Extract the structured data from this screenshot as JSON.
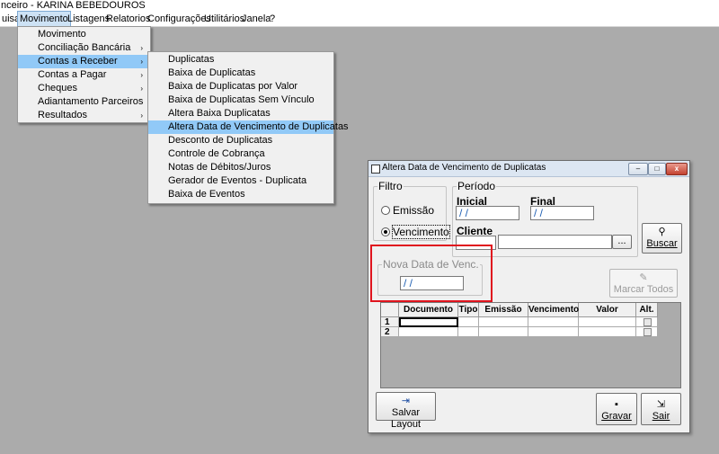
{
  "app": {
    "title": "nceiro - KARINA BEBEDOUROS"
  },
  "menubar": [
    {
      "label": "uisa"
    },
    {
      "label": "Movimento",
      "active": true
    },
    {
      "label": "Listagens"
    },
    {
      "label": "Relatorios"
    },
    {
      "label": "Configurações"
    },
    {
      "label": "Utilitários"
    },
    {
      "label": "Janela"
    },
    {
      "label": "?"
    }
  ],
  "movimento_menu": [
    {
      "label": "Movimento"
    },
    {
      "label": "Conciliação Bancária",
      "submenu": true
    },
    {
      "label": "Contas a Receber",
      "submenu": true,
      "highlight": true
    },
    {
      "label": "Contas a Pagar",
      "submenu": true
    },
    {
      "label": "Cheques",
      "submenu": true
    },
    {
      "label": "Adiantamento Parceiros"
    },
    {
      "label": "Resultados",
      "submenu": true
    }
  ],
  "receber_menu": [
    {
      "label": "Duplicatas"
    },
    {
      "label": "Baixa de Duplicatas"
    },
    {
      "label": "Baixa de Duplicatas por Valor"
    },
    {
      "label": "Baixa de Duplicatas Sem Vínculo"
    },
    {
      "label": "Altera Baixa Duplicatas"
    },
    {
      "label": "Altera Data de Vencimento de Duplicatas",
      "highlight": true
    },
    {
      "label": "Desconto de Duplicatas"
    },
    {
      "label": "Controle de Cobrança"
    },
    {
      "label": "Notas de Débitos/Juros"
    },
    {
      "label": "Gerador de Eventos - Duplicata"
    },
    {
      "label": "Baixa de Eventos"
    }
  ],
  "arrow_glyph": "›",
  "dialog": {
    "title": "Altera Data de Vencimento de Duplicatas",
    "minimize": "–",
    "restore": "□",
    "close": "x",
    "filtro": {
      "legend": "Filtro",
      "emissao": "Emissão",
      "vencimento": "Vencimento",
      "selected": "vencimento"
    },
    "periodo": {
      "legend": "Período",
      "inicial_label": "Inicial",
      "inicial_value": " / /",
      "final_label": "Final",
      "final_value": " / /",
      "cliente_label": "Cliente",
      "cliente_value": "",
      "cliente_name": "",
      "lookup_label": "..."
    },
    "buscar": {
      "label": "Buscar",
      "icon": "binoculars-icon",
      "glyph": "⚲"
    },
    "nova_data": {
      "legend": "Nova Data de Venc.",
      "value": " / /"
    },
    "marcar_todos": {
      "label": "Marcar Todos",
      "icon": "mark-all-icon",
      "glyph": "✎",
      "disabled": true
    },
    "grid": {
      "columns": [
        "",
        "Documento",
        "Tipo",
        "Emissão",
        "Vencimento",
        "Valor",
        "Alt."
      ],
      "rows": [
        {
          "num": "1",
          "documento": "",
          "tipo": "",
          "emissao": "",
          "vencimento": "",
          "valor": ""
        },
        {
          "num": "2",
          "documento": "",
          "tipo": "",
          "emissao": "",
          "vencimento": "",
          "valor": ""
        }
      ]
    },
    "salvar_layout": {
      "label": "Salvar Layout",
      "icon": "save-layout-icon",
      "glyph": "⇥"
    },
    "gravar": {
      "label": "Gravar",
      "icon": "floppy-disk-icon",
      "glyph": "▪"
    },
    "sair": {
      "label": "Sair",
      "icon": "exit-door-icon",
      "glyph": "⇲"
    }
  }
}
